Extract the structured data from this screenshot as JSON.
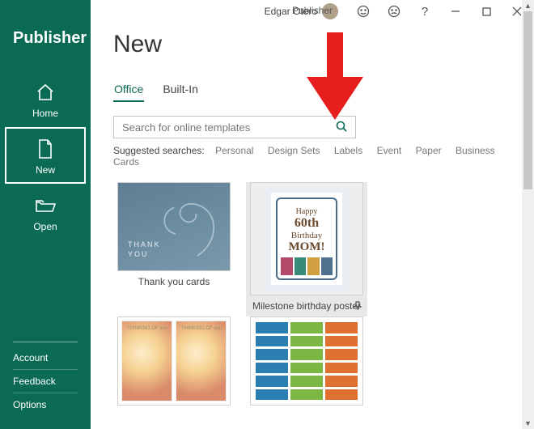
{
  "app_title": "Publisher",
  "sidebar_title": "Publisher",
  "user_name": "Edgar Otero",
  "nav": {
    "home": "Home",
    "new": "New",
    "open": "Open"
  },
  "footer": {
    "account": "Account",
    "feedback": "Feedback",
    "options": "Options"
  },
  "page": {
    "title": "New",
    "tabs": {
      "office": "Office",
      "builtin": "Built-In"
    },
    "search_placeholder": "Search for online templates",
    "suggested_label": "Suggested searches:",
    "suggested": [
      "Personal",
      "Design Sets",
      "Labels",
      "Event",
      "Paper",
      "Business",
      "Cards"
    ]
  },
  "templates": {
    "thank_you": {
      "label": "Thank you cards",
      "thumb_line1": "THANK",
      "thumb_line2": "YOU"
    },
    "milestone": {
      "label": "Milestone birthday poster",
      "t_happy": "Happy",
      "t_age": "60th",
      "t_bday": "Birthday",
      "t_mom": "MOM!"
    },
    "flower_text": "THINKING OF you"
  }
}
